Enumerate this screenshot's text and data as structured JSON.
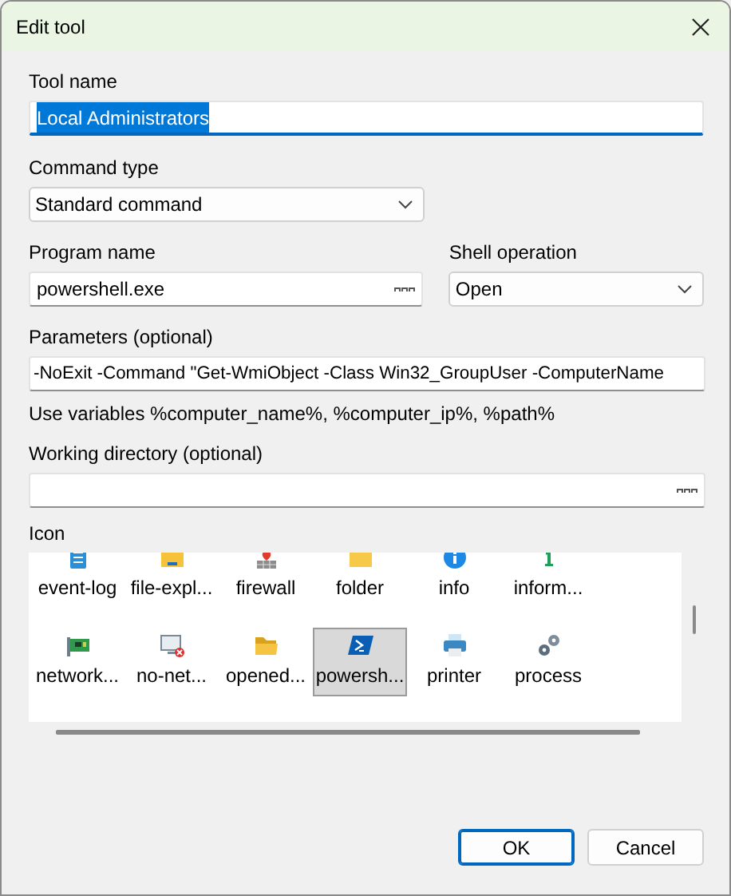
{
  "window": {
    "title": "Edit tool"
  },
  "tool_name": {
    "label": "Tool name",
    "value": "Local Administrators",
    "text_selected": true
  },
  "command_type": {
    "label": "Command type",
    "value": "Standard command"
  },
  "program_name": {
    "label": "Program name",
    "value": "powershell.exe"
  },
  "shell_operation": {
    "label": "Shell operation",
    "value": "Open"
  },
  "parameters": {
    "label": "Parameters (optional)",
    "value": "-NoExit -Command \"Get-WmiObject -Class Win32_GroupUser -ComputerName",
    "hint": "Use variables %computer_name%, %computer_ip%, %path%"
  },
  "working_directory": {
    "label": "Working directory (optional)"
  },
  "icon": {
    "label": "Icon",
    "items": [
      {
        "label": "event-log",
        "selected": false
      },
      {
        "label": "file-expl...",
        "selected": false
      },
      {
        "label": "firewall",
        "selected": false
      },
      {
        "label": "folder",
        "selected": false
      },
      {
        "label": "info",
        "selected": false
      },
      {
        "label": "inform...",
        "selected": false
      },
      {
        "label": "network...",
        "selected": false
      },
      {
        "label": "no-net...",
        "selected": false
      },
      {
        "label": "opened...",
        "selected": false
      },
      {
        "label": "powersh...",
        "selected": true
      },
      {
        "label": "printer",
        "selected": false
      },
      {
        "label": "process",
        "selected": false
      }
    ]
  },
  "buttons": [
    {
      "label": "OK",
      "default": true
    },
    {
      "label": "Cancel",
      "default": false
    }
  ]
}
